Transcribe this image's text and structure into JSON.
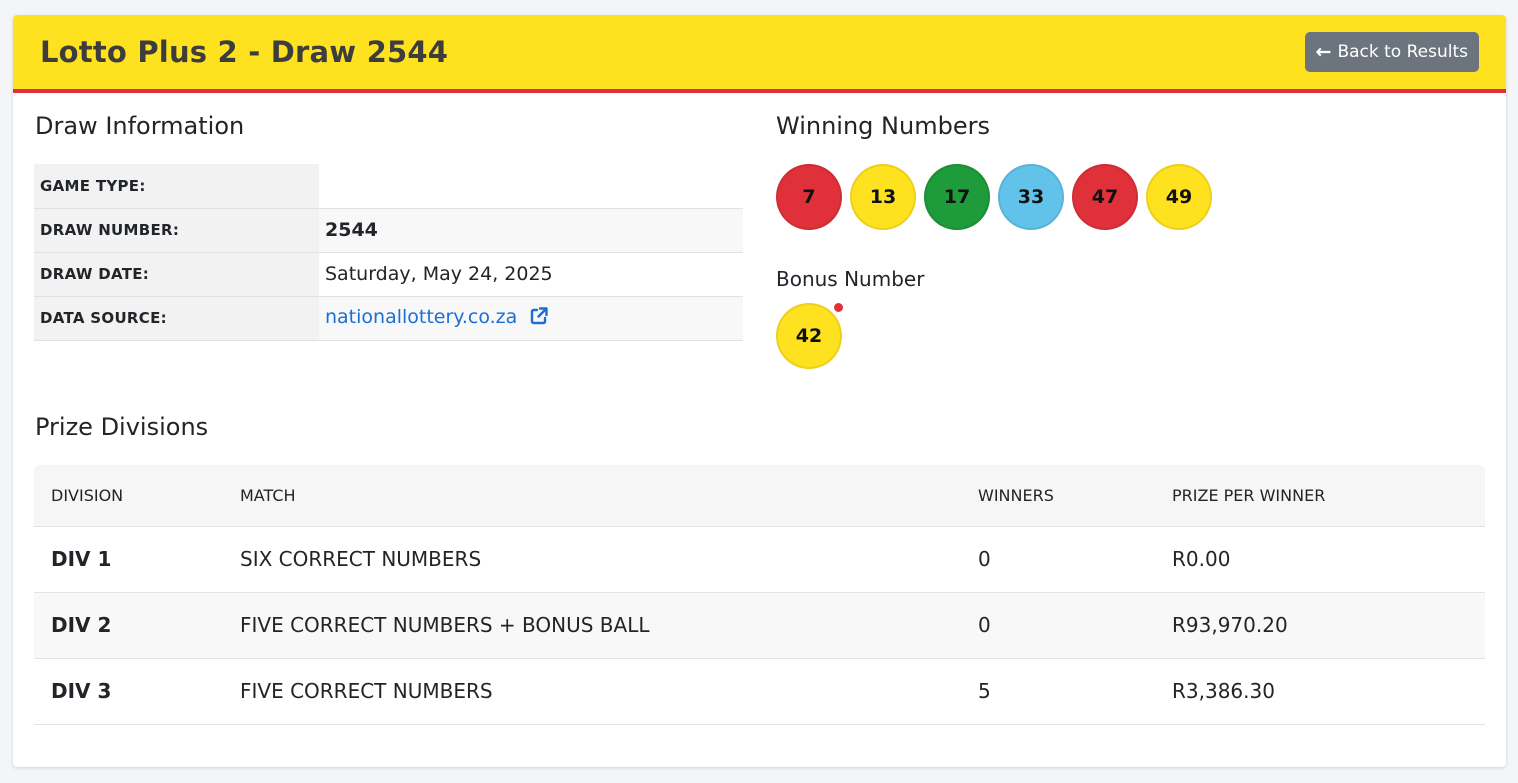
{
  "header": {
    "title": "Lotto Plus 2 - Draw 2544",
    "back_label": "Back to Results"
  },
  "draw_info": {
    "heading": "Draw Information",
    "rows": [
      {
        "label": "GAME TYPE:",
        "value": ""
      },
      {
        "label": "DRAW NUMBER:",
        "value": "2544"
      },
      {
        "label": "DRAW DATE:",
        "value": "Saturday, May 24, 2025"
      },
      {
        "label": "DATA SOURCE:",
        "value": "nationallottery.co.za"
      }
    ]
  },
  "winning_numbers": {
    "heading": "Winning Numbers",
    "balls": [
      {
        "number": "7",
        "color": "#e0313a"
      },
      {
        "number": "13",
        "color": "#ffe21f"
      },
      {
        "number": "17",
        "color": "#1e9b3a"
      },
      {
        "number": "33",
        "color": "#62c3ea"
      },
      {
        "number": "47",
        "color": "#e0313a"
      },
      {
        "number": "49",
        "color": "#ffe21f"
      }
    ],
    "bonus_heading": "Bonus Number",
    "bonus": {
      "number": "42",
      "color": "#ffe21f"
    }
  },
  "prize_divisions": {
    "heading": "Prize Divisions",
    "columns": [
      "DIVISION",
      "MATCH",
      "WINNERS",
      "PRIZE PER WINNER"
    ],
    "rows": [
      {
        "division": "DIV 1",
        "match": "SIX CORRECT NUMBERS",
        "winners": "0",
        "prize": "R0.00"
      },
      {
        "division": "DIV 2",
        "match": "FIVE CORRECT NUMBERS + BONUS BALL",
        "winners": "0",
        "prize": "R93,970.20"
      },
      {
        "division": "DIV 3",
        "match": "FIVE CORRECT NUMBERS",
        "winners": "5",
        "prize": "R3,386.30"
      }
    ]
  },
  "colors": {
    "header_bg": "#ffe21f",
    "header_accent": "#e0313a",
    "link": "#1a6fd6",
    "button_bg": "#6c757d"
  }
}
